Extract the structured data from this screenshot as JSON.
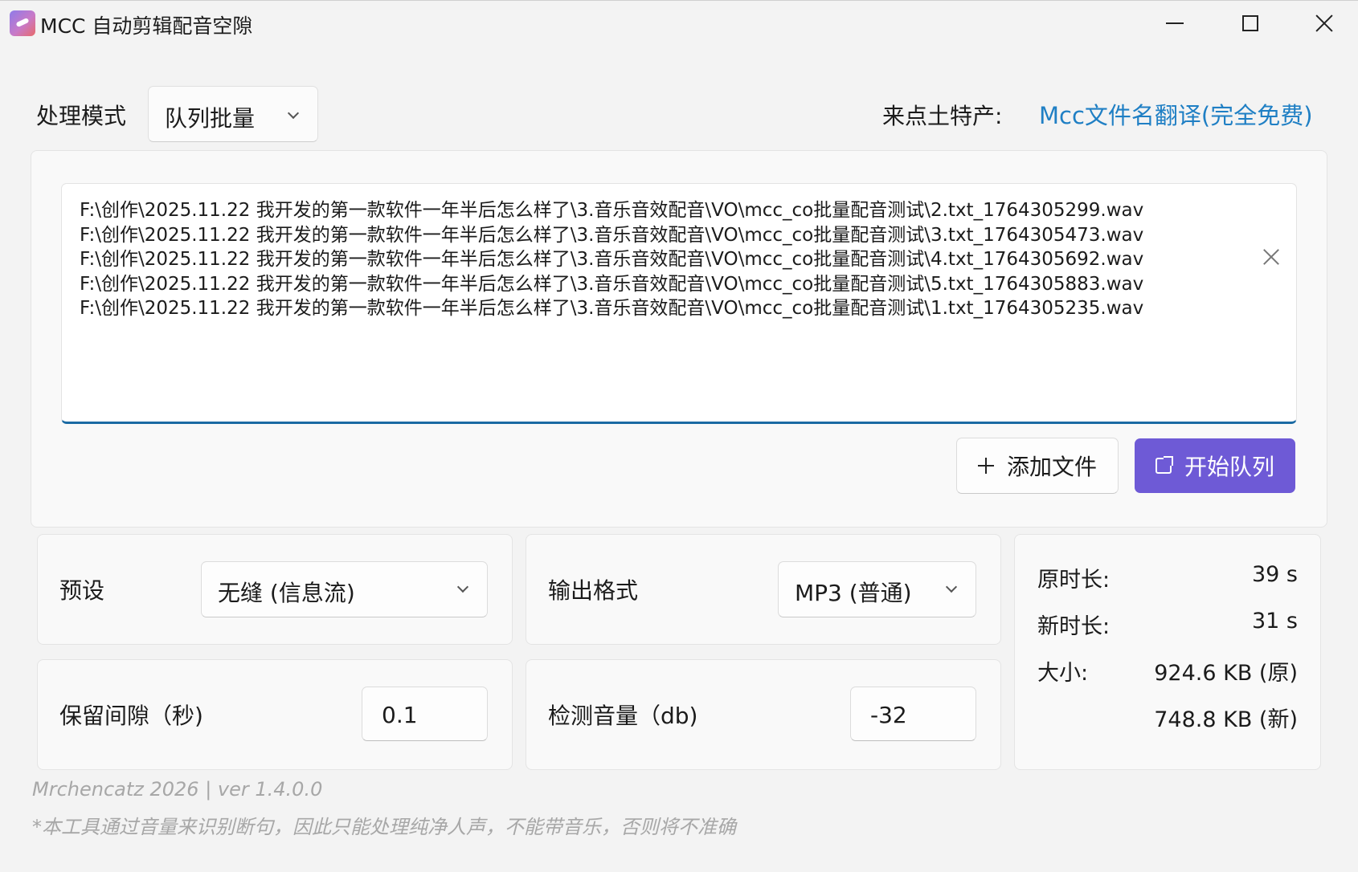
{
  "window": {
    "title": "MCC 自动剪辑配音空隙"
  },
  "mode": {
    "label": "处理模式",
    "selected": "队列批量"
  },
  "promo": {
    "label": "来点土特产:",
    "link_text": "Mcc文件名翻译(完全免费)",
    "link_color": "#1f7fc4"
  },
  "file_list": {
    "items": [
      "F:\\创作\\2025.11.22 我开发的第一款软件一年半后怎么样了\\3.音乐音效配音\\VO\\mcc_co批量配音测试\\2.txt_1764305299.wav",
      "F:\\创作\\2025.11.22 我开发的第一款软件一年半后怎么样了\\3.音乐音效配音\\VO\\mcc_co批量配音测试\\3.txt_1764305473.wav",
      "F:\\创作\\2025.11.22 我开发的第一款软件一年半后怎么样了\\3.音乐音效配音\\VO\\mcc_co批量配音测试\\4.txt_1764305692.wav",
      "F:\\创作\\2025.11.22 我开发的第一款软件一年半后怎么样了\\3.音乐音效配音\\VO\\mcc_co批量配音测试\\5.txt_1764305883.wav",
      "F:\\创作\\2025.11.22 我开发的第一款软件一年半后怎么样了\\3.音乐音效配音\\VO\\mcc_co批量配音测试\\1.txt_1764305235.wav"
    ]
  },
  "actions": {
    "add_label": "添加文件",
    "start_label": "开始队列",
    "start_color": "#6e5ad6"
  },
  "settings": {
    "preset_label": "预设",
    "preset_value": "无缝 (信息流)",
    "format_label": "输出格式",
    "format_value": "MP3 (普通)",
    "gap_label": "保留间隙（秒)",
    "gap_value": "0.1",
    "volume_label": "检测音量（db)",
    "volume_value": "-32"
  },
  "stats": {
    "orig_label": "原时长:",
    "orig_value": "39 s",
    "new_label": "新时长:",
    "new_value": "31 s",
    "size_label": "大小:",
    "size_orig": "924.6 KB (原)",
    "size_new": "748.8 KB (新)"
  },
  "footer": {
    "version": "Mrchencatz 2026 | ver 1.4.0.0",
    "note": "*本工具通过音量来识别断句，因此只能处理纯净人声，不能带音乐，否则将不准确"
  }
}
